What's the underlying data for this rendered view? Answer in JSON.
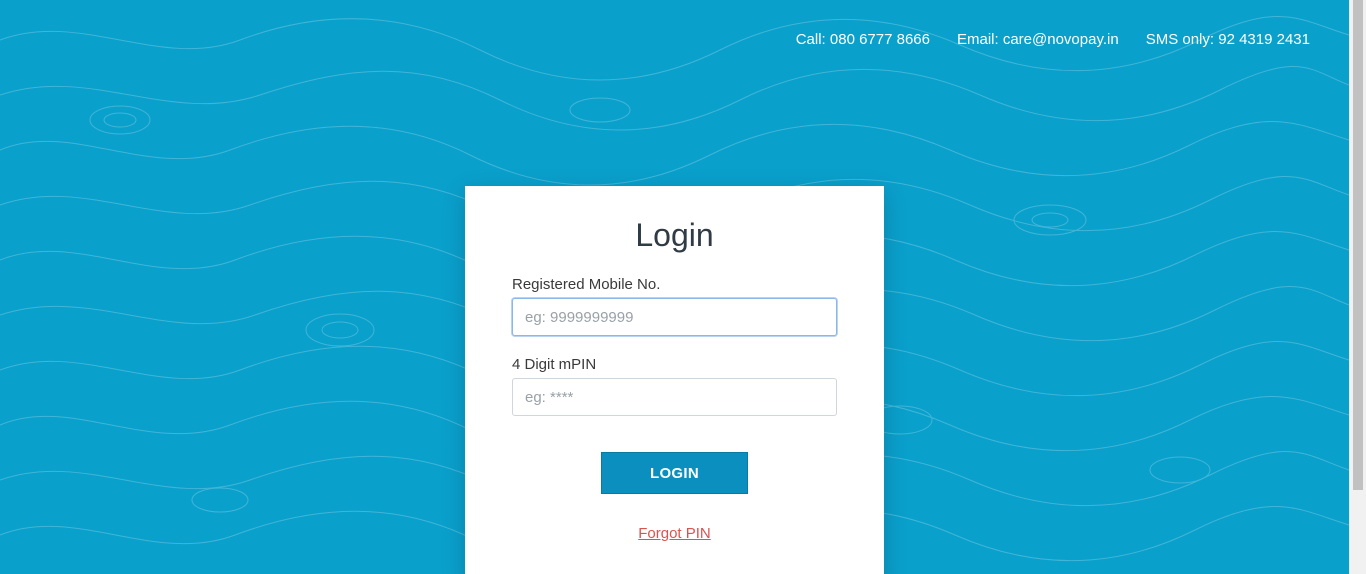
{
  "header": {
    "call": "Call: 080 6777 8666",
    "email": "Email: care@novopay.in",
    "sms": "SMS only: 92 4319 2431"
  },
  "login": {
    "title": "Login",
    "mobile_label": "Registered Mobile No.",
    "mobile_placeholder": "eg: 9999999999",
    "mobile_value": "",
    "pin_label": "4 Digit mPIN",
    "pin_placeholder": "eg: ****",
    "pin_value": "",
    "login_button": "LOGIN",
    "forgot_link": "Forgot PIN"
  },
  "colors": {
    "background": "#0aa0cc",
    "button": "#0a8fbe",
    "link": "#d9534f"
  }
}
